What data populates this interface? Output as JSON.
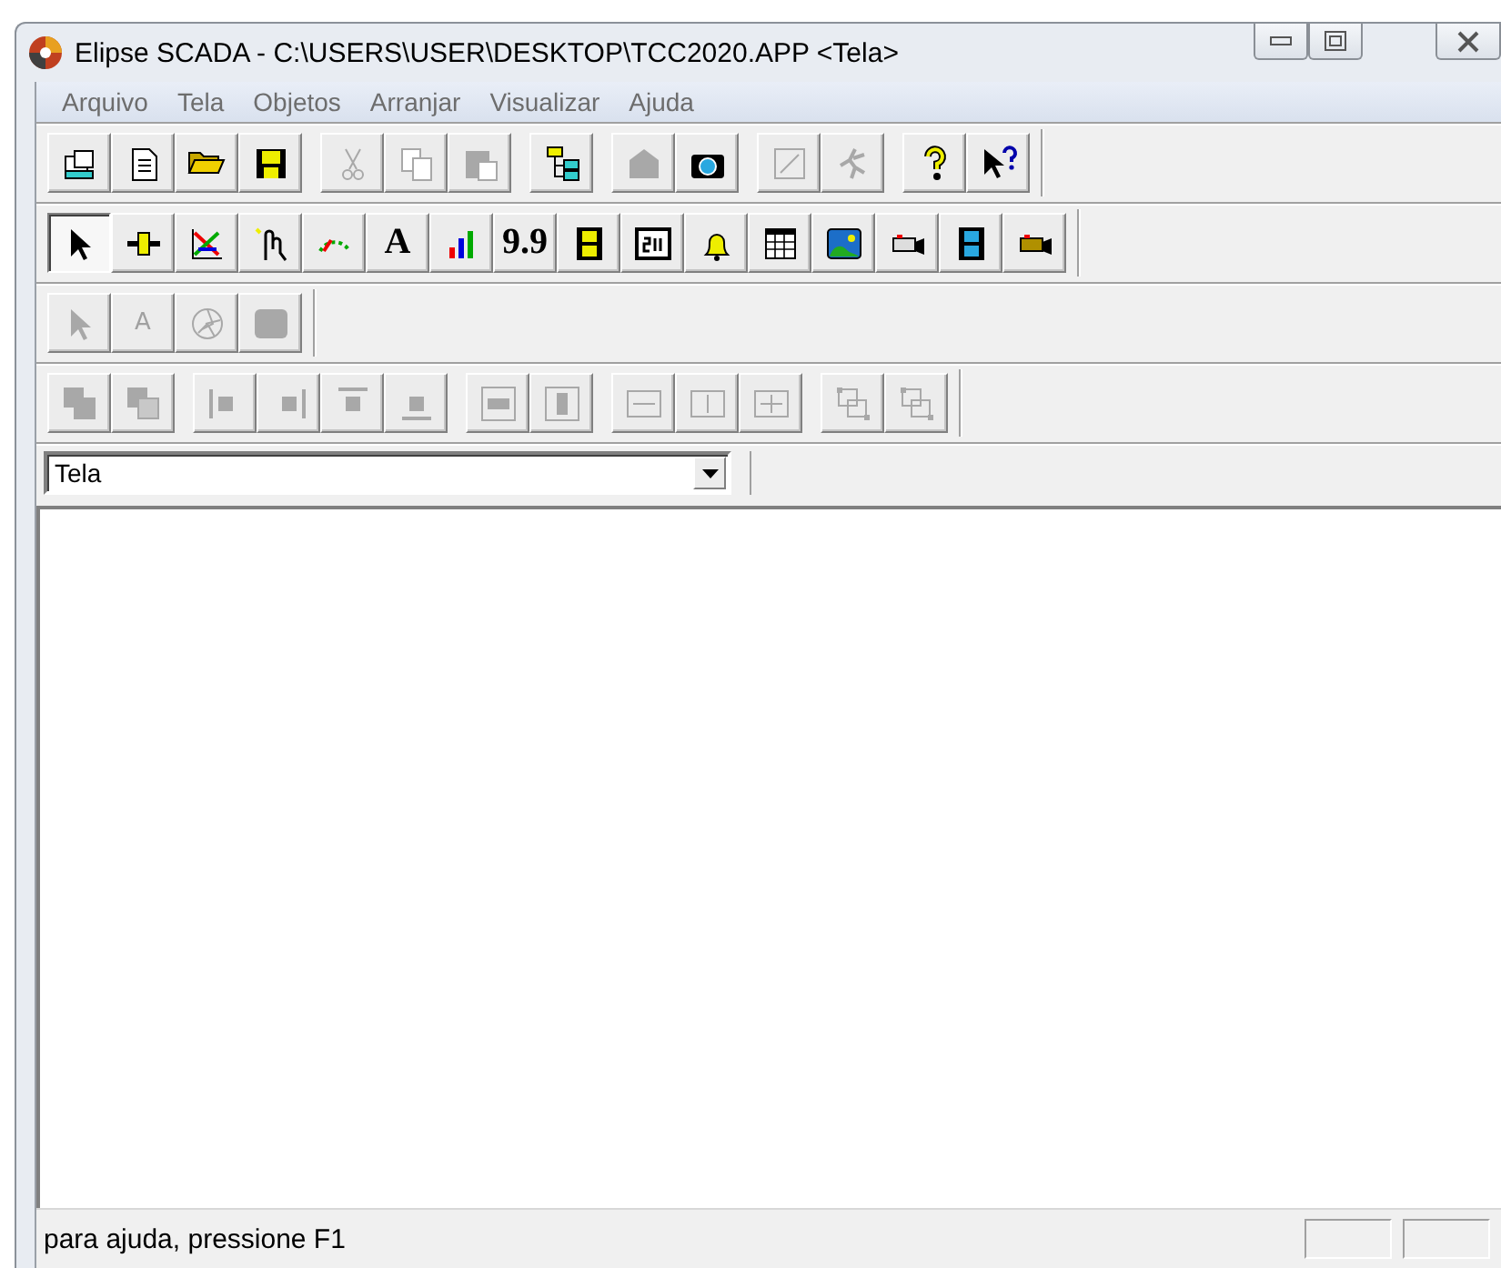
{
  "window": {
    "title": "Elipse SCADA - C:\\USERS\\USER\\DESKTOP\\TCC2020.APP <Tela>"
  },
  "menu": [
    "Arquivo",
    "Tela",
    "Objetos",
    "Arranjar",
    "Visualizar",
    "Ajuda"
  ],
  "toolbars": [
    {
      "groups": [
        [
          {
            "disabled": false
          },
          {
            "disabled": false
          },
          {
            "disabled": false
          },
          {
            "disabled": false
          }
        ],
        [
          {
            "disabled": true
          },
          {
            "disabled": true
          },
          {
            "disabled": true
          }
        ],
        [
          {
            "disabled": false
          }
        ],
        [
          {
            "disabled": true
          },
          {
            "disabled": false
          }
        ],
        [
          {
            "disabled": true
          },
          {
            "disabled": true
          }
        ],
        [
          {
            "disabled": false
          },
          {
            "disabled": false
          }
        ]
      ]
    },
    {
      "groups": [
        [
          {
            "disabled": false,
            "selected": true
          },
          {
            "disabled": false,
            "selected": false
          },
          {
            "disabled": false,
            "selected": false
          },
          {
            "disabled": false,
            "selected": false
          },
          {
            "disabled": false,
            "selected": false
          },
          {
            "disabled": false,
            "selected": false,
            "label": "A"
          },
          {
            "disabled": false,
            "selected": false
          },
          {
            "disabled": false,
            "selected": false,
            "label": "9.9"
          },
          {
            "disabled": false,
            "selected": false
          },
          {
            "disabled": false,
            "selected": false
          },
          {
            "disabled": false,
            "selected": false
          },
          {
            "disabled": false,
            "selected": false
          },
          {
            "disabled": false,
            "selected": false
          },
          {
            "disabled": false,
            "selected": false
          },
          {
            "disabled": false,
            "selected": false
          },
          {
            "disabled": false,
            "selected": false
          }
        ]
      ]
    },
    {
      "groups": [
        [
          {
            "disabled": true
          },
          {
            "disabled": true,
            "label": "A"
          },
          {
            "disabled": true
          },
          {
            "disabled": true
          }
        ]
      ]
    },
    {
      "groups": [
        [
          {
            "disabled": true
          },
          {
            "disabled": true
          }
        ],
        [
          {
            "disabled": true
          },
          {
            "disabled": true
          },
          {
            "disabled": true
          },
          {
            "disabled": true
          }
        ],
        [
          {
            "disabled": true
          },
          {
            "disabled": true
          }
        ],
        [
          {
            "disabled": true
          },
          {
            "disabled": true
          },
          {
            "disabled": true
          }
        ],
        [
          {
            "disabled": true
          },
          {
            "disabled": true
          }
        ]
      ]
    }
  ],
  "screen_select": {
    "value": "Tela"
  },
  "status_bar": {
    "text": "para ajuda, pressione F1"
  }
}
